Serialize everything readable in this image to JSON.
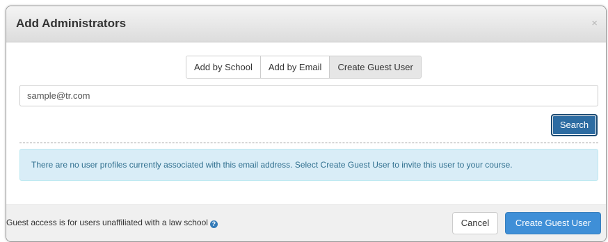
{
  "dialog": {
    "title": "Add Administrators",
    "close_glyph": "×"
  },
  "tabs": [
    {
      "label": "Add by School",
      "active": false
    },
    {
      "label": "Add by Email",
      "active": false
    },
    {
      "label": "Create Guest User",
      "active": true
    }
  ],
  "search": {
    "value": "sample@tr.com",
    "button_label": "Search"
  },
  "alert": {
    "message": "There are no user profiles currently associated with this email address. Select Create Guest User to invite this user to your course."
  },
  "footer": {
    "note": "Guest access is for users unaffiliated with a law school",
    "help_icon": "question-circle-icon",
    "help_glyph": "?",
    "cancel_label": "Cancel",
    "create_label": "Create Guest User"
  },
  "colors": {
    "primary": "#3f8fd7",
    "search_button": "#2d6ca2",
    "alert_bg": "#d9edf7",
    "alert_text": "#31708f"
  }
}
